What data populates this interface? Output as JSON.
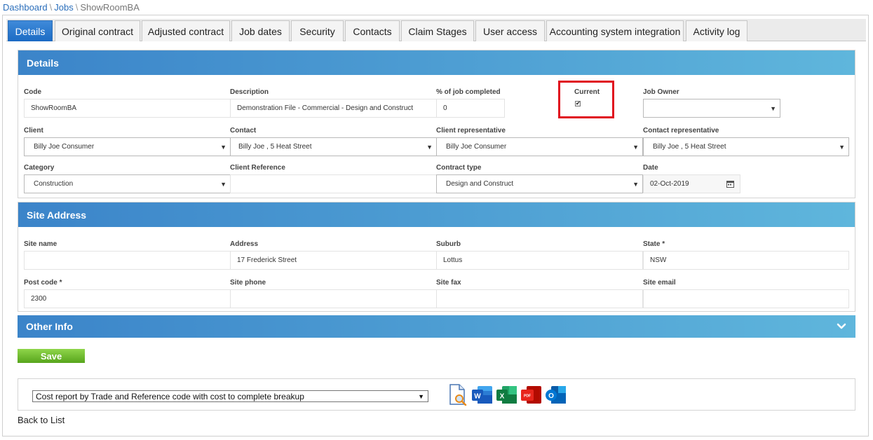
{
  "breadcrumb": {
    "dashboard": "Dashboard",
    "sep": "\\",
    "jobs": "Jobs",
    "current": "ShowRoomBA"
  },
  "tabs": [
    "Details",
    "Original contract",
    "Adjusted contract",
    "Job dates",
    "Security",
    "Contacts",
    "Claim Stages",
    "User access",
    "Accounting system integration",
    "Activity log"
  ],
  "details": {
    "title": "Details",
    "code": {
      "label": "Code",
      "value": "ShowRoomBA"
    },
    "description": {
      "label": "Description",
      "value": "Demonstration File - Commercial - Design and Construct"
    },
    "pct": {
      "label": "% of job completed",
      "value": "0"
    },
    "current": {
      "label": "Current",
      "checked": true,
      "mark": "✔"
    },
    "job_owner": {
      "label": "Job Owner",
      "value": ""
    },
    "client": {
      "label": "Client",
      "value": "Billy Joe Consumer"
    },
    "contact": {
      "label": "Contact",
      "value": "Billy Joe , 5 Heat Street"
    },
    "client_rep": {
      "label": "Client representative",
      "value": "Billy Joe Consumer"
    },
    "contact_rep": {
      "label": "Contact representative",
      "value": "Billy Joe , 5 Heat Street"
    },
    "category": {
      "label": "Category",
      "value": "Construction"
    },
    "client_ref": {
      "label": "Client Reference",
      "value": ""
    },
    "contract_type": {
      "label": "Contract type",
      "value": "Design and Construct"
    },
    "date": {
      "label": "Date",
      "value": "02-Oct-2019"
    }
  },
  "site": {
    "title": "Site Address",
    "site_name": {
      "label": "Site name",
      "value": ""
    },
    "address": {
      "label": "Address",
      "value": "17 Frederick Street"
    },
    "suburb": {
      "label": "Suburb",
      "value": "Lottus"
    },
    "state": {
      "label": "State *",
      "value": "NSW"
    },
    "postcode": {
      "label": "Post code *",
      "value": "2300"
    },
    "phone": {
      "label": "Site phone",
      "value": ""
    },
    "fax": {
      "label": "Site fax",
      "value": ""
    },
    "email": {
      "label": "Site email",
      "value": ""
    }
  },
  "other_info": {
    "title": "Other Info"
  },
  "save_label": "Save",
  "report": {
    "selected": "Cost report by Trade and Reference code with cost to complete breakup",
    "icons": [
      "preview-icon",
      "word-icon",
      "excel-icon",
      "pdf-icon",
      "outlook-icon"
    ],
    "icon_letters": {
      "word": "W",
      "excel": "X",
      "pdf": "PDF",
      "outlook": "O"
    }
  },
  "back_label": "Back to List",
  "colors": {
    "header_start": "#3b84c9",
    "header_end": "#5fb6dc",
    "save": "#6dbb2c",
    "highlight": "#e0101e",
    "tab_active": "#2a79cf"
  }
}
